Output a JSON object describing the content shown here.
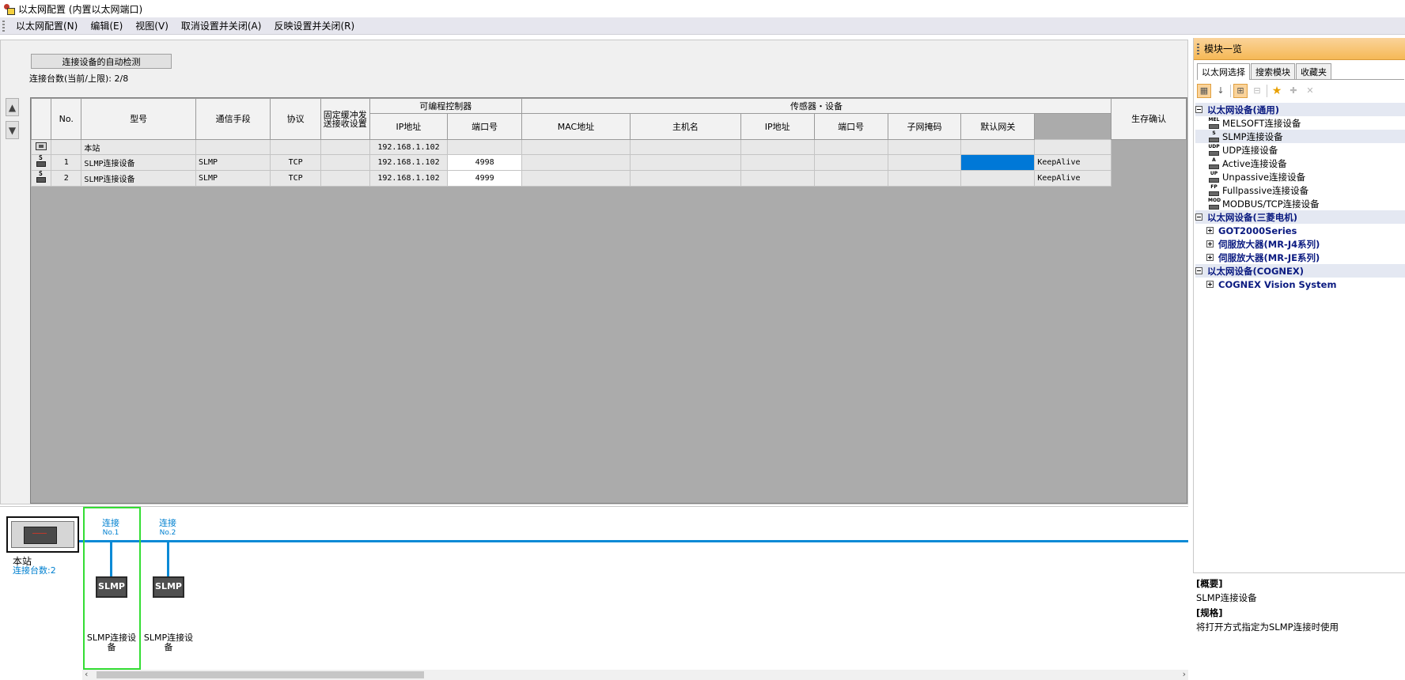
{
  "window": {
    "title": "以太网配置 (内置以太网端口)"
  },
  "menu": [
    "以太网配置(N)",
    "编辑(E)",
    "视图(V)",
    "取消设置并关闭(A)",
    "反映设置并关闭(R)"
  ],
  "toolbar": {
    "auto_detect_label": "连接设备的自动检测"
  },
  "connection_count": {
    "label": "连接台数(当前/上限):",
    "value": "2/8"
  },
  "table": {
    "headers": {
      "no": "No.",
      "model": "型号",
      "comm_method": "通信手段",
      "protocol": "协议",
      "fixed_buffer": "固定缓冲发送接收设置",
      "plc_group": "可编程控制器",
      "plc_ip": "IP地址",
      "plc_port": "端口号",
      "sensor_group": "传感器・设备",
      "mac": "MAC地址",
      "hostname": "主机名",
      "sensor_ip": "IP地址",
      "sensor_port": "端口号",
      "subnet": "子网掩码",
      "gateway": "默认网关",
      "alive": "生存确认"
    },
    "host_row": {
      "model": "本站",
      "plc_ip": "192.168.1.102"
    },
    "rows": [
      {
        "no": "1",
        "model": "SLMP连接设备",
        "comm": "SLMP",
        "protocol": "TCP",
        "plc_ip": "192.168.1.102",
        "plc_port": "4998",
        "alive": "KeepAlive"
      },
      {
        "no": "2",
        "model": "SLMP连接设备",
        "comm": "SLMP",
        "protocol": "TCP",
        "plc_ip": "192.168.1.102",
        "plc_port": "4999",
        "alive": "KeepAlive"
      }
    ]
  },
  "diagram": {
    "host_label": "本站",
    "host_count": "连接台数:2",
    "connections": [
      {
        "label": "连接",
        "no": "No.1",
        "box": "SLMP",
        "device": "SLMP连接设备"
      },
      {
        "label": "连接",
        "no": "No.2",
        "box": "SLMP",
        "device": "SLMP连接设备"
      }
    ]
  },
  "panel": {
    "title": "模块一览",
    "tabs": [
      "以太网选择",
      "搜索模块",
      "收藏夹"
    ],
    "tools": [
      "sort-category-icon",
      "sort-alpha-icon",
      "expand-all-icon",
      "collapse-all-icon",
      "star-icon",
      "add-favorite-icon",
      "delete-icon"
    ],
    "tree": [
      {
        "type": "cat",
        "label": "以太网设备(通用)"
      },
      {
        "type": "leaf",
        "icon": "MEL",
        "label": "MELSOFT连接设备"
      },
      {
        "type": "leaf",
        "icon": "S",
        "label": "SLMP连接设备",
        "selected": true
      },
      {
        "type": "leaf",
        "icon": "UDP",
        "label": "UDP连接设备"
      },
      {
        "type": "leaf",
        "icon": "A",
        "label": "Active连接设备"
      },
      {
        "type": "leaf",
        "icon": "UP",
        "label": "Unpassive连接设备"
      },
      {
        "type": "leaf",
        "icon": "FP",
        "label": "Fullpassive连接设备"
      },
      {
        "type": "leaf",
        "icon": "MOD",
        "label": "MODBUS/TCP连接设备"
      },
      {
        "type": "cat",
        "label": "以太网设备(三菱电机)"
      },
      {
        "type": "sub",
        "label": "GOT2000Series"
      },
      {
        "type": "sub",
        "label": "伺服放大器(MR-J4系列)"
      },
      {
        "type": "sub",
        "label": "伺服放大器(MR-JE系列)"
      },
      {
        "type": "cat",
        "label": "以太网设备(COGNEX)"
      },
      {
        "type": "sub",
        "label": "COGNEX Vision System"
      }
    ],
    "description": {
      "summary_title": "[概要]",
      "summary": "SLMP连接设备",
      "spec_title": "[规格]",
      "spec": "将打开方式指定为SLMP连接时使用"
    }
  },
  "colors": {
    "accent": "#0a8ad6",
    "selection": "#0078d7",
    "panel_header": "#f6b956",
    "highlight": "#33dd33"
  }
}
